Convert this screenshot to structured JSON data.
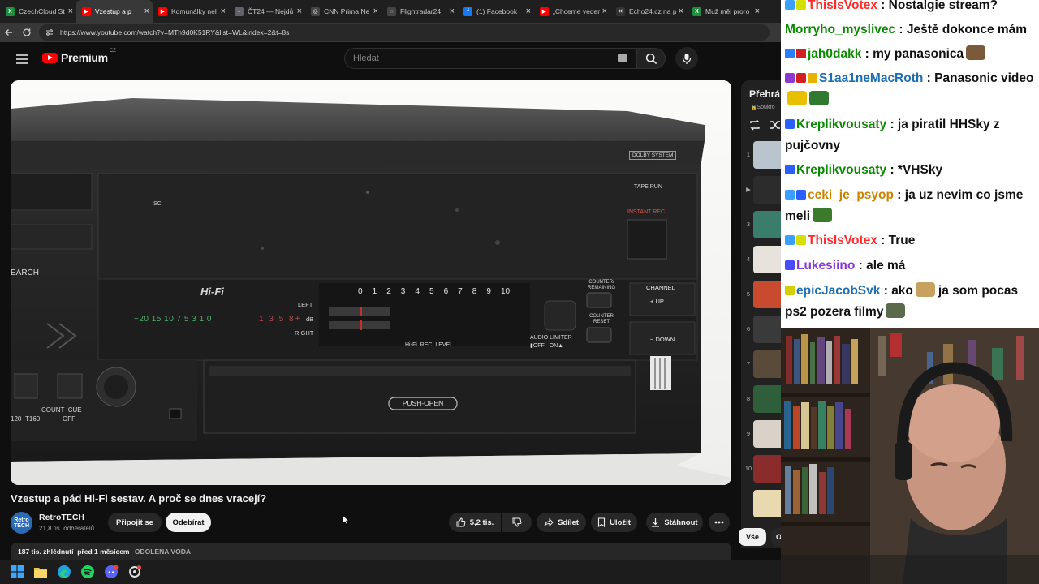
{
  "browser": {
    "tabs": [
      {
        "title": "CzechCloud St",
        "fav_color": "#1e8e3e",
        "fav_glyph": "X",
        "active": false
      },
      {
        "title": "Vzestup a p",
        "fav_color": "#ff0000",
        "fav_glyph": "▶",
        "active": true
      },
      {
        "title": "Komunálky nel",
        "fav_color": "#ff0000",
        "fav_glyph": "▶",
        "active": false
      },
      {
        "title": "ČT24 — Nejdů",
        "fav_color": "#5f6368",
        "fav_glyph": "▪",
        "active": false
      },
      {
        "title": "CNN Prima Ne",
        "fav_color": "#444444",
        "fav_glyph": "◎",
        "active": false
      },
      {
        "title": "Flightradar24",
        "fav_color": "#444444",
        "fav_glyph": "◌",
        "active": false
      },
      {
        "title": "(1) Facebook",
        "fav_color": "#1877f2",
        "fav_glyph": "f",
        "active": false
      },
      {
        "title": "„Chceme veden",
        "fav_color": "#ff0000",
        "fav_glyph": "▶",
        "active": false
      },
      {
        "title": "Echo24.cz na p",
        "fav_color": "#333333",
        "fav_glyph": "✕",
        "active": false
      },
      {
        "title": "Muž měl proro",
        "fav_color": "#1e8e3e",
        "fav_glyph": "X",
        "active": false
      }
    ],
    "url": "https://www.youtube.com/watch?v=MTh9d0K51RY&list=WL&index=2&t=8s"
  },
  "youtube": {
    "brand": "Premium",
    "region": "CZ",
    "search_placeholder": "Hledat"
  },
  "video": {
    "title": "Vzestup a pád Hi-Fi sestav. A proč se dnes vracejí?",
    "channel": {
      "avatar_text": "Retro TECH",
      "name": "RetroTECH",
      "subscribers": "21,8 tis. odběratelů"
    },
    "buttons": {
      "join": "Připojit se",
      "subscribe": "Odebírat",
      "likes": "5,2 tis.",
      "share": "Sdílet",
      "save": "Uložit",
      "download": "Stáhnout"
    },
    "description": {
      "views": "187 tis. zhlédnutí",
      "date": "před 1 měsícem",
      "tag": "ODOLENA VODA"
    },
    "deck_labels": {
      "dolby": "DOLBY SYSTEM",
      "tape_run": "TAPE RUN",
      "instant_rec": "INSTANT REC",
      "sc": "SC",
      "search": "EARCH",
      "hifi": "Hi-Fi",
      "left": "LEFT",
      "db": "dB",
      "right": "RIGHT",
      "db_scale": "−20 15 10 7 5 3 1 0",
      "db_red": "1 3 5 8+",
      "meter_scale": [
        "0",
        "1",
        "2",
        "3",
        "4",
        "5",
        "6",
        "7",
        "8",
        "9",
        "10"
      ],
      "hifi_rec_level": "Hi-Fi  REC  LEVEL",
      "audio_limiter": "AUDIO LIMITER",
      "off_on": "▮OFF   ON▲",
      "counter_remaining": "COUNTER/ REMAINING",
      "counter_reset": "COUNTER RESET",
      "channel": "CHANNEL",
      "up": "+ UP",
      "down": "− DOWN",
      "push_open": "PUSH-OPEN",
      "count_cue": "COUNT  CUE",
      "off": "OFF",
      "t160": "T160",
      "t120": "120"
    }
  },
  "playlist": {
    "title": "Přehrá",
    "subtitle": "Soukro",
    "items": [
      {
        "num": "1",
        "color": "#b9c4cf"
      },
      {
        "num": "▶",
        "color": "#2c2c2c"
      },
      {
        "num": "3",
        "color": "#3a7d6a"
      },
      {
        "num": "4",
        "color": "#e7e3dc"
      },
      {
        "num": "5",
        "color": "#c94b2f"
      },
      {
        "num": "6",
        "color": "#3a3a3a"
      },
      {
        "num": "7",
        "color": "#5a4a3a"
      },
      {
        "num": "8",
        "color": "#2e5e3a"
      },
      {
        "num": "9",
        "color": "#d9d2c8"
      },
      {
        "num": "10",
        "color": "#8a2c2c"
      },
      {
        "num": "",
        "color": "#e9d9b0"
      }
    ],
    "chips": {
      "all": "Vše",
      "next": "O"
    }
  },
  "chat": {
    "messages": [
      {
        "badges": [
          "#3aa0ff",
          "#d4e000"
        ],
        "user": "ThisIsVotex",
        "user_color": "#ff2a2a",
        "text": "Nostalgie stream?",
        "emotes": []
      },
      {
        "badges": [],
        "user": "Morryho_myslivec",
        "user_color": "#0a8a00",
        "text": "Ještě dokonce mám",
        "emotes": []
      },
      {
        "badges": [
          "#2a7fff",
          "#d12020"
        ],
        "user": "jah0dakk",
        "user_color": "#0a8a00",
        "text": "my panasonica",
        "emotes": [
          "#7a5a3a"
        ]
      },
      {
        "badges": [
          "#8a3ad0",
          "#d12020",
          "#e8b000"
        ],
        "user": "S1aa1neMacRoth",
        "user_color": "#1e6eb0",
        "text": "Panasonic video",
        "emotes": [
          "#e8c000",
          "#2f7a2f"
        ]
      },
      {
        "badges": [
          "#2a5fff"
        ],
        "user": "Kreplikvousaty",
        "user_color": "#0a8a00",
        "text": "ja piratil HHSky z pujčovny",
        "emotes": []
      },
      {
        "badges": [
          "#2a5fff"
        ],
        "user": "Kreplikvousaty",
        "user_color": "#0a8a00",
        "text": "*VHSky",
        "emotes": []
      },
      {
        "badges": [
          "#3aa0ff",
          "#2a5fff"
        ],
        "user": "ceki_je_psyop",
        "user_color": "#c88400",
        "text": "ja uz nevim co jsme meli",
        "emotes": [
          "#3a7a2a"
        ]
      },
      {
        "badges": [
          "#3aa0ff",
          "#d4e000"
        ],
        "user": "ThisIsVotex",
        "user_color": "#ff2a2a",
        "text": "True",
        "emotes": []
      },
      {
        "badges": [
          "#4a4aff"
        ],
        "user": "Lukesiino",
        "user_color": "#8a3ad0",
        "text": "ale má",
        "emotes": []
      },
      {
        "badges": [
          "#d4d000"
        ],
        "user": "epicJacobSvk",
        "user_color": "#1e6eb0",
        "text": "ako",
        "text2": "ja som pocas ps2 pozera filmy",
        "emotes": [
          "#c8a060",
          "#5a6a4a"
        ]
      }
    ]
  },
  "colors": {
    "yt_red": "#ff0000",
    "background": "#0f0f0f",
    "chip": "#272727"
  }
}
